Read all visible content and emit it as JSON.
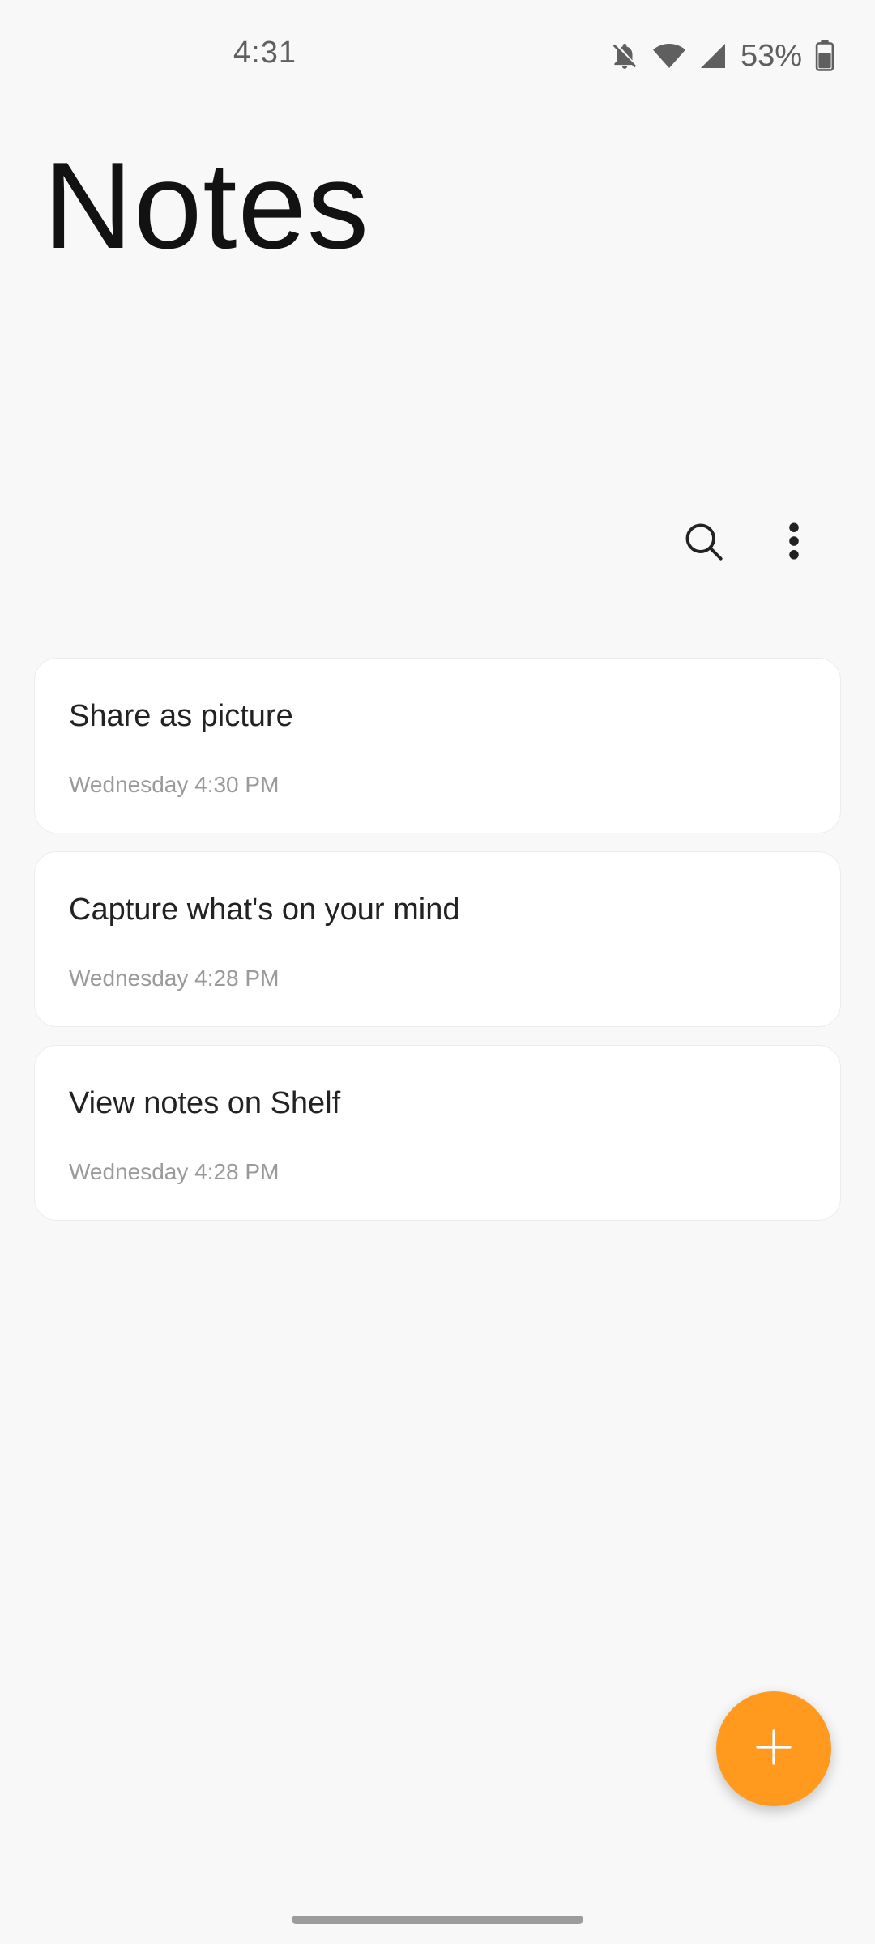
{
  "status_bar": {
    "time": "4:31",
    "battery_percent": "53%",
    "icons": [
      "bell-off-icon",
      "wifi-icon",
      "signal-icon",
      "battery-icon"
    ]
  },
  "page": {
    "title": "Notes"
  },
  "toolbar": {
    "icons": [
      "search-icon",
      "more-vert-icon"
    ]
  },
  "notes": [
    {
      "title": "Share as picture",
      "date": "Wednesday 4:30 PM"
    },
    {
      "title": "Capture what's on your mind",
      "date": "Wednesday 4:28 PM"
    },
    {
      "title": "View notes on Shelf",
      "date": "Wednesday 4:28 PM"
    }
  ],
  "fab": {
    "icon": "plus-icon",
    "color": "#ff9a1f"
  }
}
